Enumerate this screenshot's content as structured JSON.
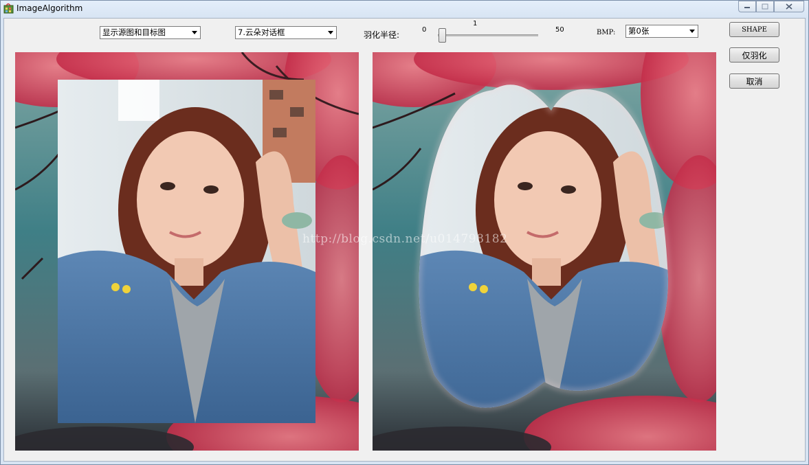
{
  "window": {
    "title": "ImageAlgorithm"
  },
  "toolbar": {
    "display_mode": "显示源图和目标图",
    "shape_select": "7.云朵对话框",
    "feather_label": "羽化半径:",
    "slider_min": "0",
    "slider_value": "1",
    "slider_max": "50",
    "bmp_label": "BMP:",
    "bmp_select": "第0张"
  },
  "buttons": {
    "shape": "SHAPE",
    "feather_only": "仅羽化",
    "cancel": "取消"
  },
  "watermark": "http://blog.csdn.net/u014798182",
  "colors": {
    "client_bg": "#f0f0f0",
    "foliage": "#d9405a",
    "teal_mist": "#3f7f86"
  },
  "icons": {
    "app": "app-icon",
    "combo_arrow": "chevron-down-icon",
    "minimize": "minimize-icon",
    "maximize": "maximize-icon",
    "close": "close-icon"
  }
}
